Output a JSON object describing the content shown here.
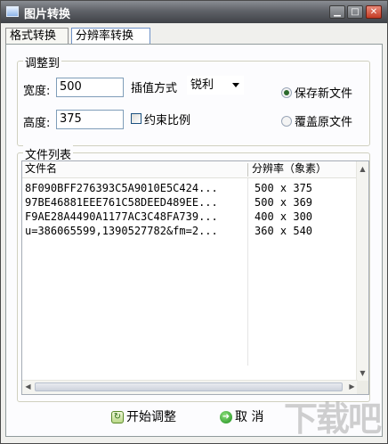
{
  "window": {
    "title": "图片转换",
    "minimize_glyph": "▁",
    "maximize_glyph": "□",
    "close_glyph": "✕"
  },
  "tabs": [
    {
      "label": "格式转换"
    },
    {
      "label": "分辨率转换"
    }
  ],
  "adjust": {
    "group_title": "调整到",
    "width_label": "宽度:",
    "width_value": "500",
    "height_label": "高度:",
    "height_value": "375",
    "interp_label": "插值方式",
    "interp_value": "锐利",
    "keep_ratio_label": "约束比例",
    "keep_ratio_checked": false,
    "save_new_label": "保存新文件",
    "overwrite_label": "覆盖原文件",
    "selected_mode": "save_new"
  },
  "file_list": {
    "group_title": "文件列表",
    "columns": [
      "文件名",
      "分辨率（象素）"
    ],
    "rows": [
      {
        "name": "8F090BFF276393C5A9010E5C424...",
        "resolution": "500 x 375"
      },
      {
        "name": "97BE46881EEE761C58DEED489EE...",
        "resolution": "500 x 369"
      },
      {
        "name": "F9AE28A4490A1177AC3C48FA739...",
        "resolution": "400 x 300"
      },
      {
        "name": "u=386065599,1390527782&fm=2...",
        "resolution": "360 x 540"
      }
    ]
  },
  "buttons": {
    "start_label": "开始调整",
    "cancel_label": "取 消"
  },
  "watermark": "下载吧",
  "colors": {
    "titlebar_top": "#8a8d93",
    "titlebar_bottom": "#3f4247",
    "window_bg": "#f0f0ed",
    "close_button": "#c43c24"
  },
  "icons": {
    "app": "app-image-icon",
    "start": "refresh-doc-icon",
    "cancel": "green-arrow-icon"
  }
}
